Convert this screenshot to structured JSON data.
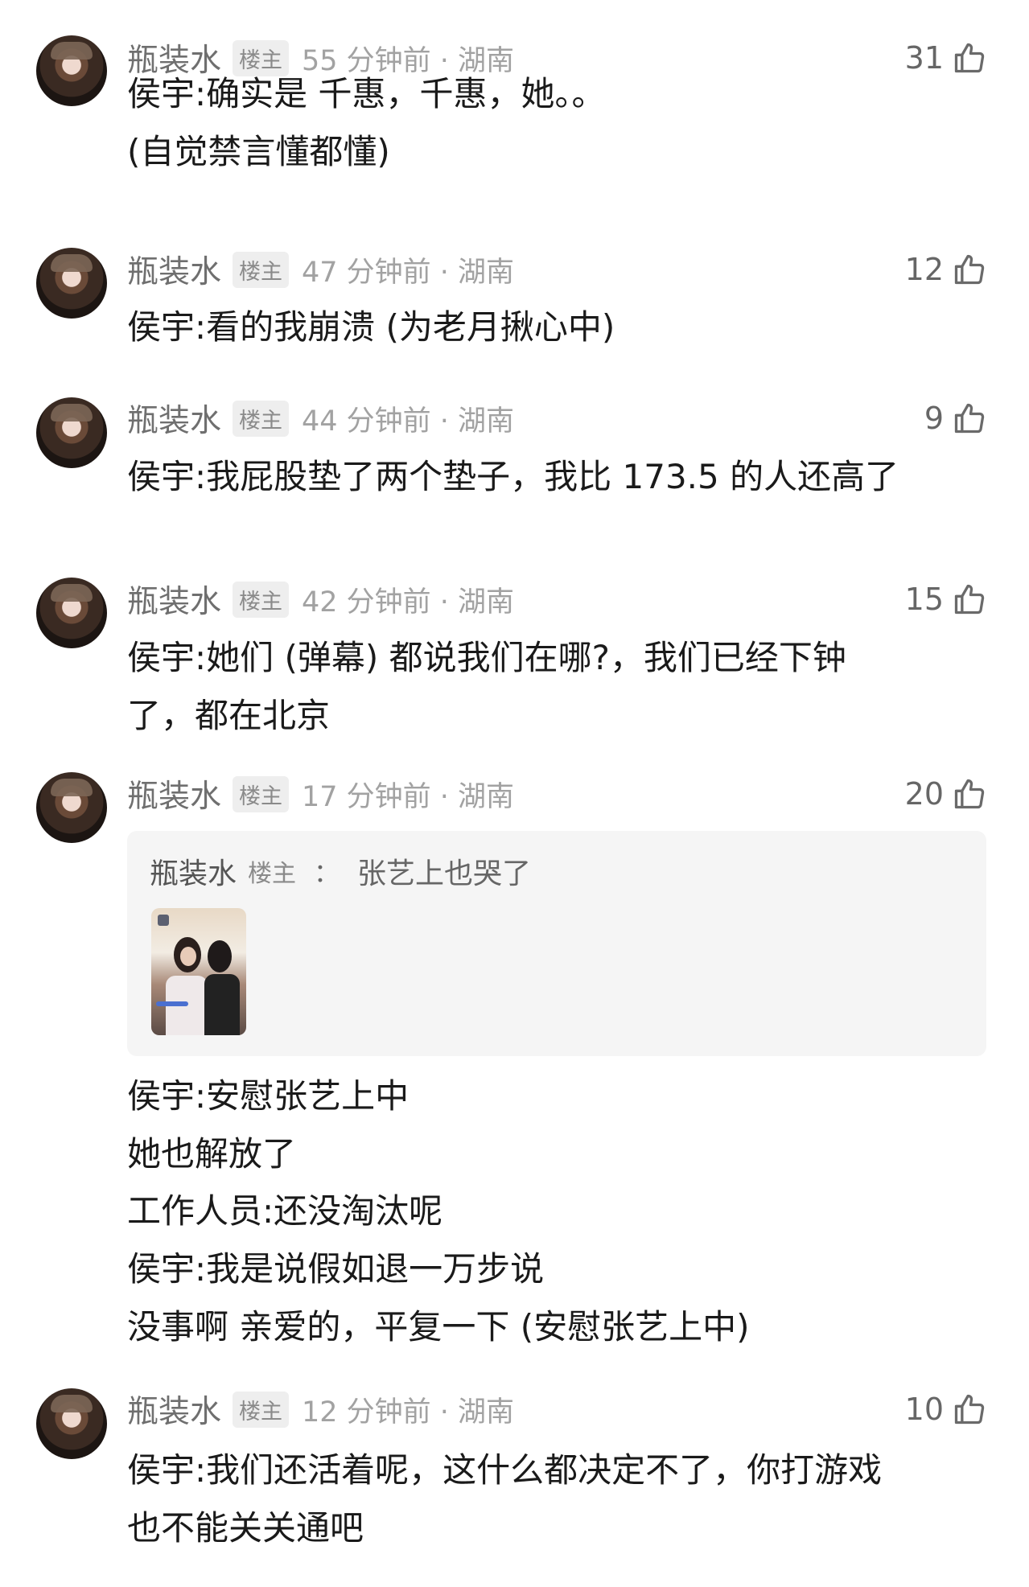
{
  "comments": [
    {
      "username": "瓶装水",
      "badge": "楼主",
      "time": "55 分钟前 · 湖南",
      "likes": "31",
      "lines": [
        "侯宇:确实是 千惠，千惠，她。。",
        "(自觉禁言懂都懂)"
      ]
    },
    {
      "username": "瓶装水",
      "badge": "楼主",
      "time": "47 分钟前 · 湖南",
      "likes": "12",
      "lines": [
        "侯宇:看的我崩溃 (为老月揪心中)"
      ]
    },
    {
      "username": "瓶装水",
      "badge": "楼主",
      "time": "44 分钟前 · 湖南",
      "likes": "9",
      "lines": [
        "侯宇:我屁股垫了两个垫子，我比 173.5 的人还高了"
      ]
    },
    {
      "username": "瓶装水",
      "badge": "楼主",
      "time": "42 分钟前 · 湖南",
      "likes": "15",
      "lines": [
        "侯宇:她们 (弹幕) 都说我们在哪?，我们已经下钟",
        "了，都在北京"
      ]
    },
    {
      "username": "瓶装水",
      "badge": "楼主",
      "time": "17 分钟前 · 湖南",
      "likes": "20",
      "quote": {
        "username": "瓶装水",
        "badge": "楼主",
        "separator": "：",
        "text": "张艺上也哭了"
      },
      "lines": [
        "侯宇:安慰张艺上中",
        "她也解放了",
        "工作人员:还没淘汰呢",
        "侯宇:我是说假如退一万步说",
        "没事啊 亲爱的，平复一下 (安慰张艺上中)"
      ]
    },
    {
      "username": "瓶装水",
      "badge": "楼主",
      "time": "12 分钟前 · 湖南",
      "likes": "10",
      "lines": [
        "侯宇:我们还活着呢，这什么都决定不了，你打游戏",
        "也不能关关通吧"
      ]
    }
  ]
}
